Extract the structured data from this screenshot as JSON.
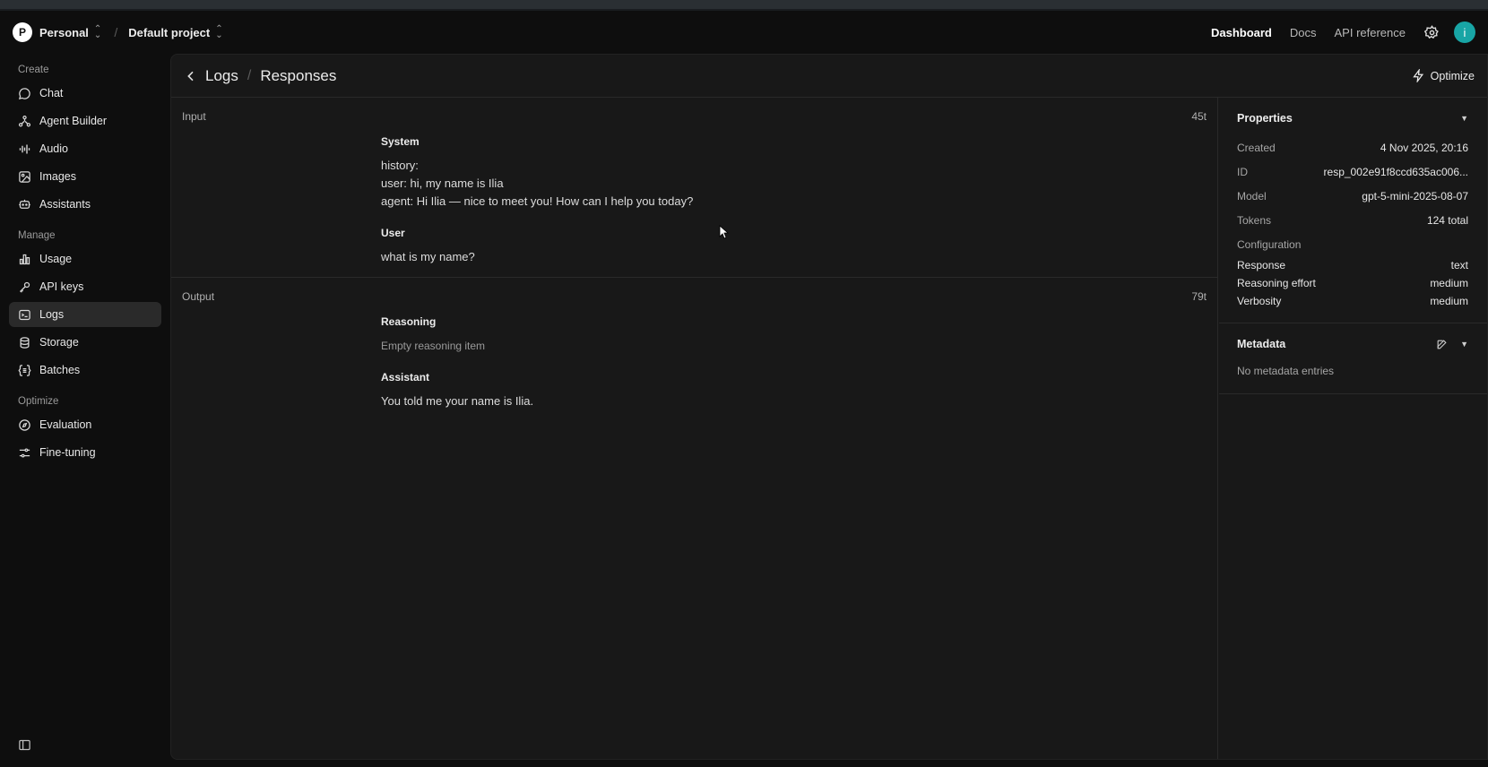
{
  "workspace": {
    "avatar_letter": "P",
    "name": "Personal",
    "project": "Default project"
  },
  "topnav": {
    "dashboard": "Dashboard",
    "docs": "Docs",
    "api_reference": "API reference",
    "user_initial": "i"
  },
  "sidebar": {
    "create_label": "Create",
    "create_items": [
      {
        "label": "Chat",
        "icon": "chat-icon"
      },
      {
        "label": "Agent Builder",
        "icon": "agent-builder-icon"
      },
      {
        "label": "Audio",
        "icon": "audio-icon"
      },
      {
        "label": "Images",
        "icon": "images-icon"
      },
      {
        "label": "Assistants",
        "icon": "assistants-icon"
      }
    ],
    "manage_label": "Manage",
    "manage_items": [
      {
        "label": "Usage",
        "icon": "usage-icon"
      },
      {
        "label": "API keys",
        "icon": "key-icon"
      },
      {
        "label": "Logs",
        "icon": "logs-icon",
        "active": true
      },
      {
        "label": "Storage",
        "icon": "storage-icon"
      },
      {
        "label": "Batches",
        "icon": "batches-icon"
      }
    ],
    "optimize_label": "Optimize",
    "optimize_items": [
      {
        "label": "Evaluation",
        "icon": "evaluation-icon"
      },
      {
        "label": "Fine-tuning",
        "icon": "fine-tuning-icon"
      }
    ]
  },
  "header": {
    "logs": "Logs",
    "responses": "Responses",
    "optimize": "Optimize"
  },
  "input": {
    "label": "Input",
    "tokens": "45t",
    "system_role": "System",
    "system_lines": [
      "history:",
      "user: hi, my name is Ilia",
      "agent: Hi Ilia — nice to meet you! How can I help you today?"
    ],
    "user_role": "User",
    "user_text": "what is my name?"
  },
  "output": {
    "label": "Output",
    "tokens": "79t",
    "reasoning_role": "Reasoning",
    "reasoning_text": "Empty reasoning item",
    "assistant_role": "Assistant",
    "assistant_text": "You told me your name is Ilia."
  },
  "properties": {
    "title": "Properties",
    "created_k": "Created",
    "created_v": "4 Nov 2025, 20:16",
    "id_k": "ID",
    "id_v": "resp_002e91f8ccd635ac006...",
    "model_k": "Model",
    "model_v": "gpt-5-mini-2025-08-07",
    "tokens_k": "Tokens",
    "tokens_v": "124 total",
    "configuration_k": "Configuration",
    "response_k": "Response",
    "response_v": "text",
    "reasoning_k": "Reasoning effort",
    "reasoning_v": "medium",
    "verbosity_k": "Verbosity",
    "verbosity_v": "medium"
  },
  "metadata": {
    "title": "Metadata",
    "empty": "No metadata entries"
  }
}
